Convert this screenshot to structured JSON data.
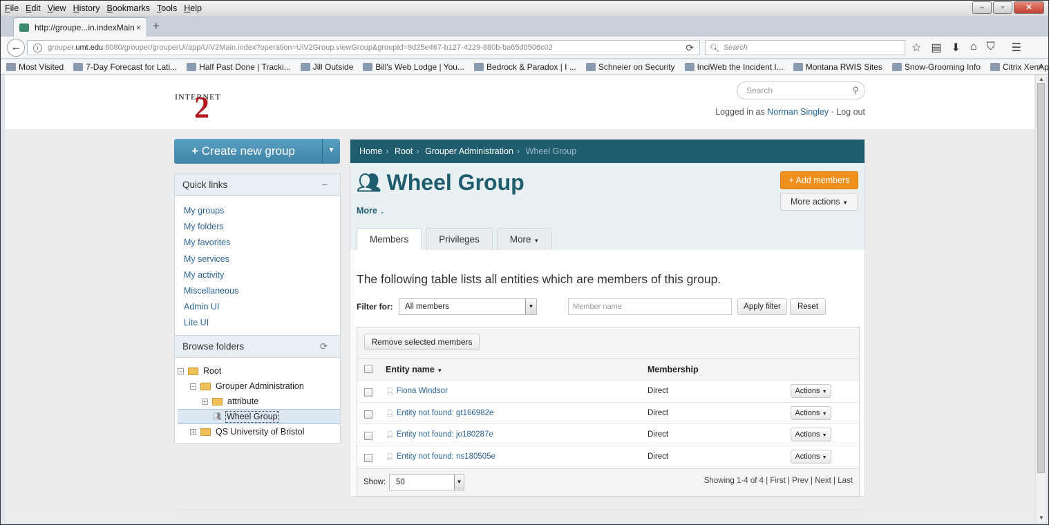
{
  "menubar": [
    "File",
    "Edit",
    "View",
    "History",
    "Bookmarks",
    "Tools",
    "Help"
  ],
  "window_controls": {
    "minimize": "–",
    "maximize": "▫",
    "close": "✕"
  },
  "tab": {
    "title": "http://groupe...in.indexMain",
    "close": "×",
    "new": "+"
  },
  "url": {
    "pre": "grouper.",
    "host": "umt.edu",
    "post": ":8080/grouper/grouperUi/app/UiV2Main.index?operation=UiV2Group.viewGroup&groupId=9d25e467-b127-4229-880b-ba65d0506c02"
  },
  "browser_search_placeholder": "Search",
  "bookmarks": [
    "Most Visited",
    "7-Day Forecast for Lati...",
    "Half Past Done | Tracki...",
    "Jill Outside",
    "Bill's Web Lodge | You...",
    "Bedrock & Paradox | I ...",
    "Schneier on Security",
    "InciWeb the Incident I...",
    "Montana RWIS Sites",
    "Snow-Grooming Info",
    "Citrix XenApp - Logon"
  ],
  "logo": {
    "text_top": "INTERNET",
    "digit": "2"
  },
  "header": {
    "search_placeholder": "Search",
    "logged_in_prefix": "Logged in as",
    "user_name": "Norman Singley",
    "separator": "·",
    "logout": "Log out"
  },
  "create_button": {
    "label": "Create new group",
    "plus": "+"
  },
  "quick_links": {
    "title": "Quick links",
    "collapse": "−",
    "items": [
      "My groups",
      "My folders",
      "My favorites",
      "My services",
      "My activity",
      "Miscellaneous",
      "Admin UI",
      "Lite UI"
    ]
  },
  "browse_folders": {
    "title": "Browse folders",
    "refresh": "⟳",
    "tree": [
      {
        "label": "Root",
        "toggle": "−"
      },
      {
        "label": "Grouper Administration",
        "toggle": "−"
      },
      {
        "label": "attribute",
        "toggle": "+"
      },
      {
        "label": "Wheel Group"
      },
      {
        "label": "QS University of Bristol",
        "toggle": "+"
      }
    ]
  },
  "breadcrumb": [
    "Home",
    "Root",
    "Grouper Administration",
    "Wheel Group"
  ],
  "group": {
    "title": "Wheel Group",
    "more_label": "More",
    "add_members": "Add members",
    "more_actions": "More actions"
  },
  "tabs": [
    "Members",
    "Privileges",
    "More"
  ],
  "description": "The following table lists all entities which are members of this group.",
  "filter": {
    "label": "Filter for:",
    "selected": "All members",
    "member_placeholder": "Member name",
    "apply": "Apply filter",
    "reset": "Reset"
  },
  "table": {
    "remove_button": "Remove selected members",
    "columns": [
      "Entity name",
      "Membership"
    ],
    "rows": [
      {
        "name": "Fiona Windsor",
        "membership": "Direct",
        "action": "Actions"
      },
      {
        "name": "Entity not found: gt166982e",
        "membership": "Direct",
        "action": "Actions"
      },
      {
        "name": "Entity not found: jo180287e",
        "membership": "Direct",
        "action": "Actions"
      },
      {
        "name": "Entity not found: ns180505e",
        "membership": "Direct",
        "action": "Actions"
      }
    ],
    "show_label": "Show:",
    "page_size": "50",
    "showing": "Showing 1-4 of 4",
    "pager": [
      "First",
      "Prev",
      "Next",
      "Last"
    ]
  }
}
